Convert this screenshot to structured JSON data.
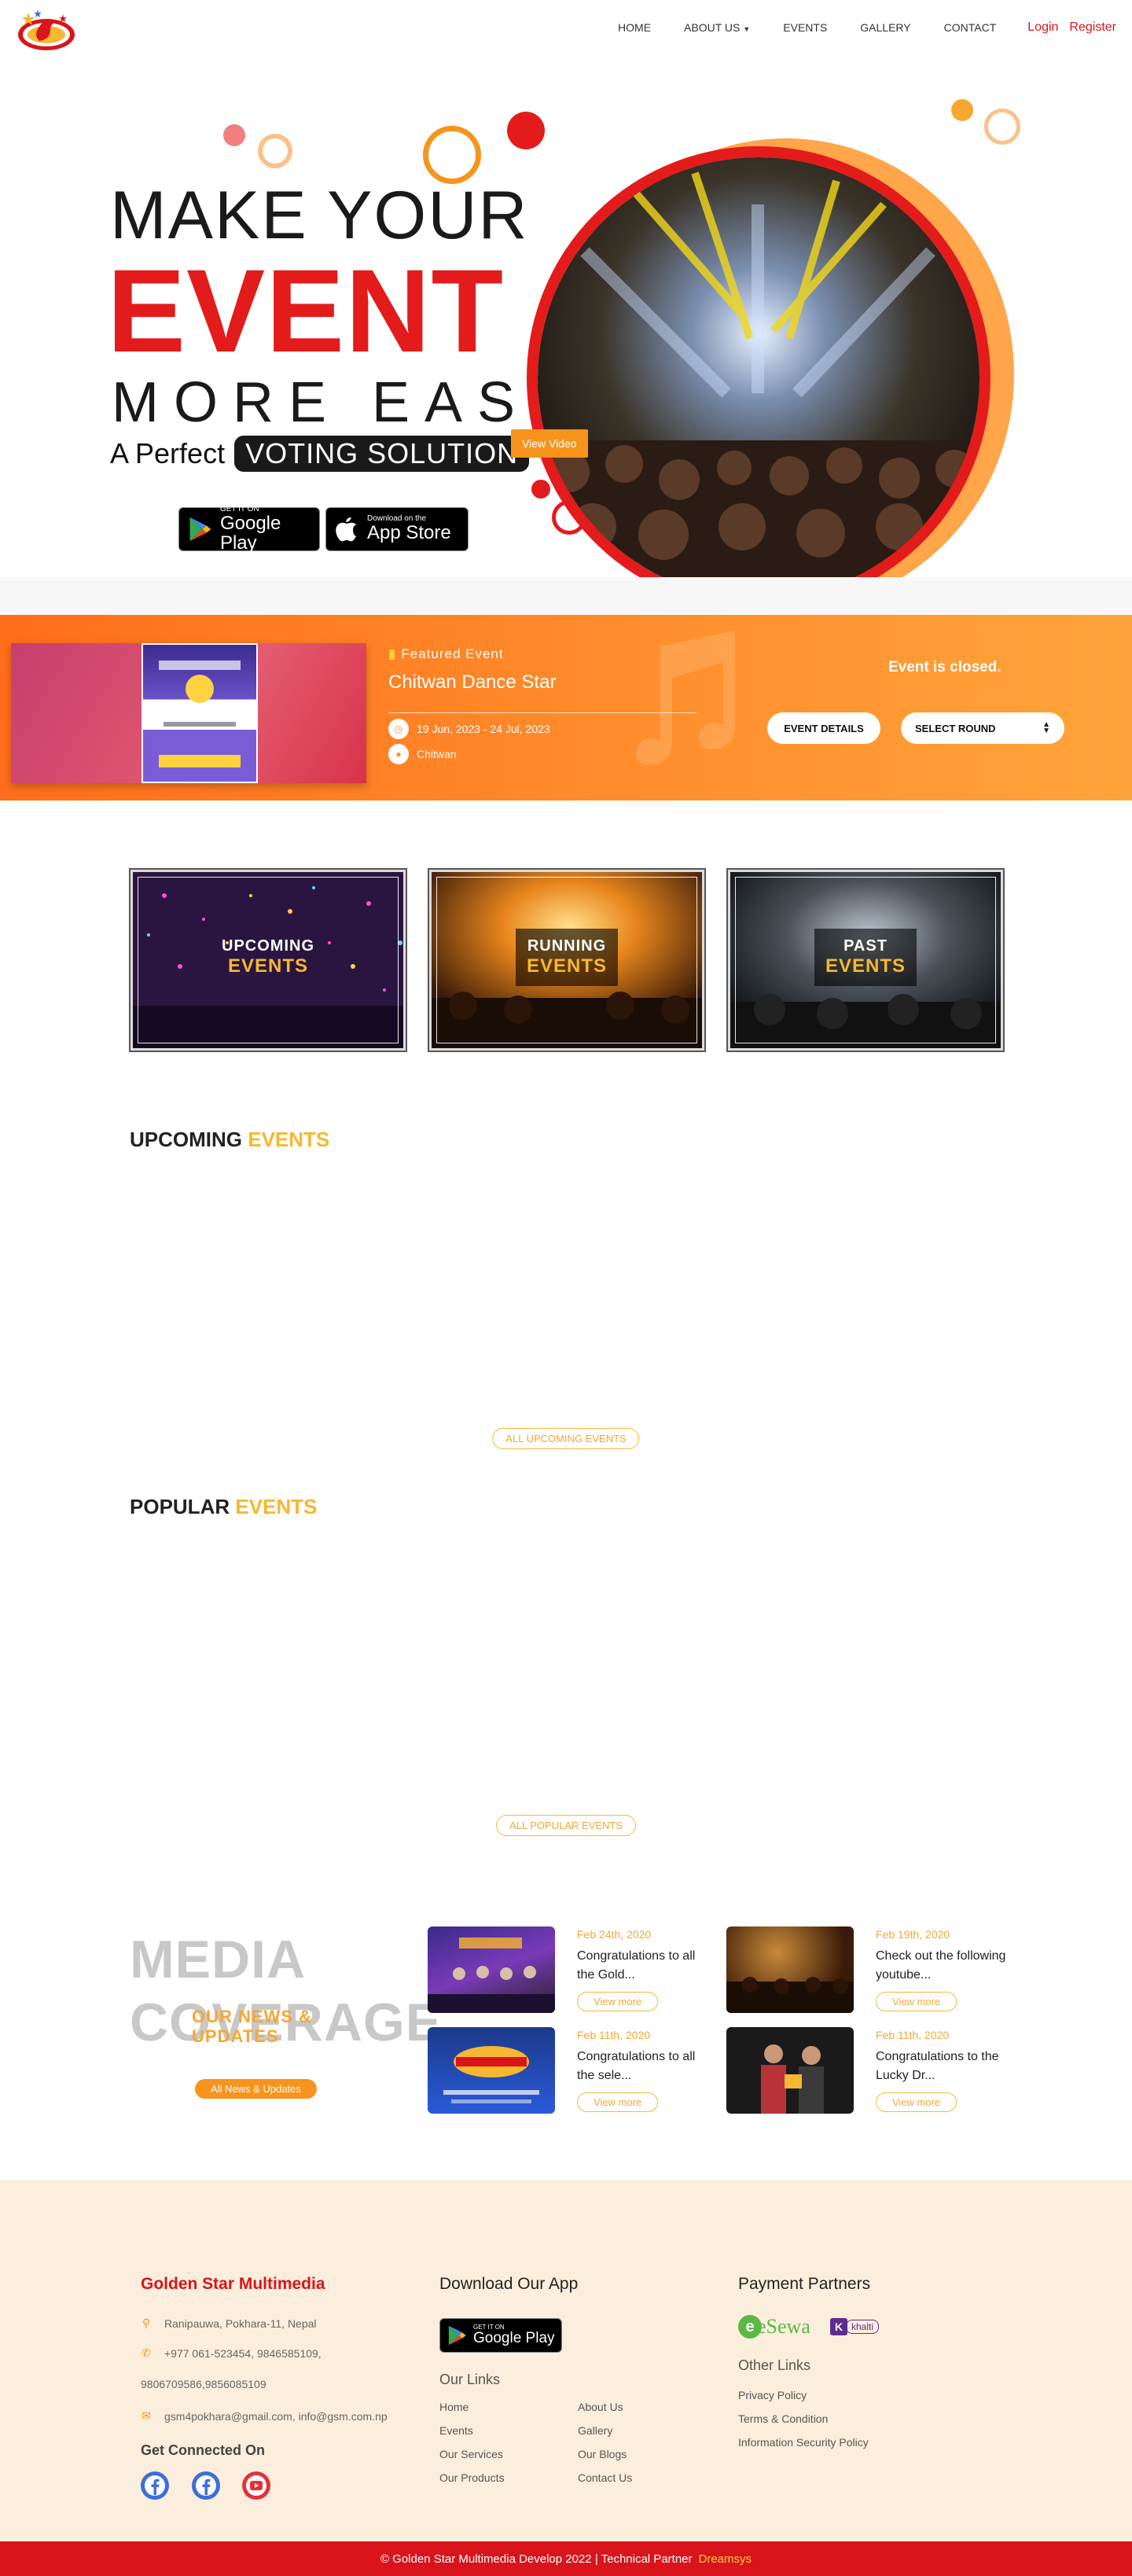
{
  "nav": {
    "items": [
      {
        "label": "HOME"
      },
      {
        "label": "ABOUT US",
        "has_dropdown": true
      },
      {
        "label": "EVENTS"
      },
      {
        "label": "GALLERY"
      },
      {
        "label": "CONTACT"
      }
    ],
    "login": "Login",
    "register": "Register"
  },
  "hero": {
    "line1": "MAKE YOUR",
    "line2": "EVENT",
    "line3": "MORE EASY",
    "perfect": "A Perfect",
    "voting": "VOTING SOLUTION",
    "view_video": "View Video",
    "google_small": "GET IT ON",
    "google_big": "Google Play",
    "apple_small": "Download on the",
    "apple_big": "App Store"
  },
  "featured": {
    "tag": "Featured Event",
    "title": "Chitwan Dance Star",
    "dates": "19 Jun, 2023 - 24 Jul, 2023",
    "location": "Chitwan",
    "status": "Event is closed.",
    "details_btn": "EVENT DETAILS",
    "select_round": "SELECT ROUND"
  },
  "categories": [
    {
      "line1": "UPCOMING",
      "line2": "EVENTS"
    },
    {
      "line1": "RUNNING",
      "line2": "EVENTS"
    },
    {
      "line1": "PAST",
      "line2": "EVENTS"
    }
  ],
  "upcoming": {
    "title_a": "UPCOMING",
    "title_b": "EVENTS",
    "all_btn": "ALL UPCOMING EVENTS"
  },
  "popular": {
    "title_a": "POPULAR",
    "title_b": "EVENTS",
    "all_btn": "ALL POPULAR EVENTS"
  },
  "media": {
    "big1": "MEDIA",
    "big2": "COVERAGE",
    "news1": "OUR NEWS &",
    "news2": "UPDATES",
    "all_btn": "All News & Updates",
    "items": [
      {
        "date": "Feb 24th, 2020",
        "text": "Congratulations to all the Gold...",
        "more": "View more"
      },
      {
        "date": "Feb 19th, 2020",
        "text": "Check out the following youtube...",
        "more": "View more"
      },
      {
        "date": "Feb 11th, 2020",
        "text": "Congratulations to all the sele...",
        "more": "View more"
      },
      {
        "date": "Feb 11th, 2020",
        "text": "Congratulations to the Lucky Dr...",
        "more": "View more"
      }
    ]
  },
  "footer": {
    "company": "Golden Star Multimedia",
    "address": "Ranipauwa, Pokhara-11, Nepal",
    "phone1": "+977 061-523454, 9846585109,",
    "phone2": "9806709586,9856085109",
    "email": "gsm4pokhara@gmail.com, info@gsm.com.np",
    "connected": "Get Connected On",
    "download_title": "Download Our App",
    "google_small": "GET IT ON",
    "google_big": "Google Play",
    "links_title": "Our Links",
    "links_col1": [
      "Home",
      "Events",
      "Our Services",
      "Our Products"
    ],
    "links_col2": [
      "About Us",
      "Gallery",
      "Our Blogs",
      "Contact Us"
    ],
    "payment_title": "Payment Partners",
    "esewa": "eSewa",
    "khalti": "khalti",
    "other_title": "Other Links",
    "other_links": [
      "Privacy Policy",
      "Terms & Condition",
      "Information Security Policy"
    ],
    "copyright": "© Golden Star Multimedia Develop 2022 | Technical Partner",
    "partner": "Dreamsys"
  },
  "colors": {
    "brand_red": "#d9141b",
    "accent_orange": "#f7941d",
    "accent_yellow": "#f7b731",
    "footer_bg": "#fbeedc"
  }
}
